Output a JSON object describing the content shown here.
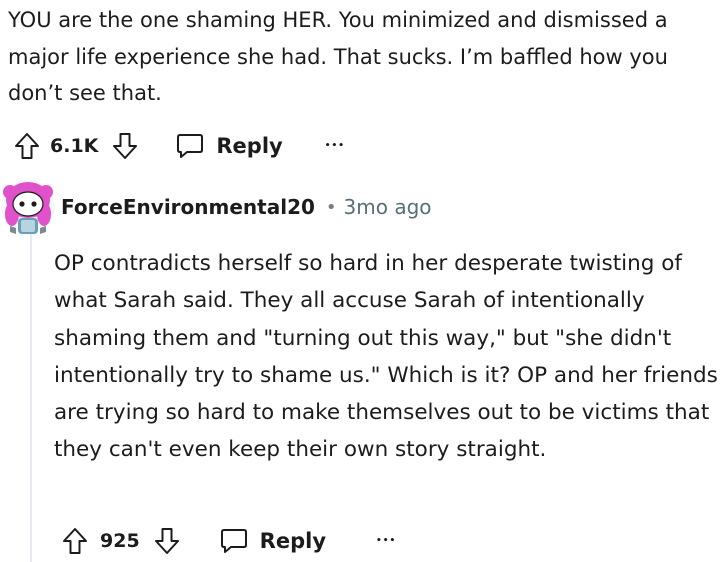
{
  "parent_comment": {
    "text": "YOU are the one shaming HER. You minimized and dismissed a major life experience she had. That sucks. I’m baffled how you don’t see that.",
    "votes": "6.1K",
    "reply_label": "Reply",
    "more_label": "•••"
  },
  "child_comment": {
    "username": "ForceEnvironmental20",
    "separator": "•",
    "time": "3mo ago",
    "text": "OP contradicts herself so hard in her desperate twisting of what Sarah said. They all accuse Sarah of intentionally shaming them and \"turning out this way,\" but \"she didn't intentionally try to shame us.\" Which is it? OP and her friends are trying so hard to make themselves out to be victims that they can't even keep their own story straight.",
    "votes": "925",
    "reply_label": "Reply",
    "more_label": "•••",
    "avatar_icon": "snoo-avatar-icon"
  },
  "colors": {
    "text": "#1c1c1c",
    "muted": "#576f76",
    "thread_line": "#e5ebee",
    "avatar_hair": "#e052c9"
  }
}
